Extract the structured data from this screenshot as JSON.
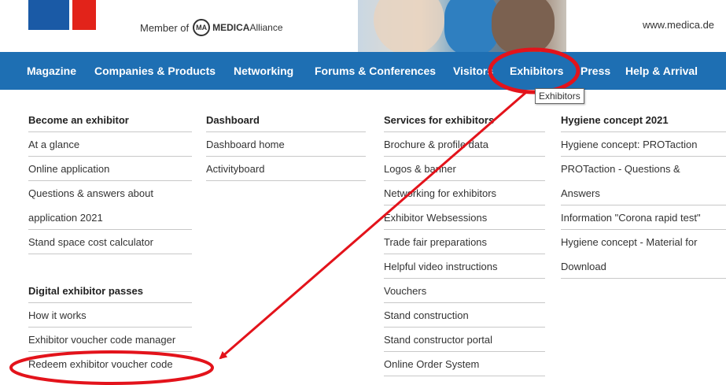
{
  "header": {
    "member_prefix": "Member of",
    "alliance_mark": "MA",
    "alliance_brand_bold": "MEDICA",
    "alliance_brand_rest": "Alliance",
    "site_url": "www.medica.de"
  },
  "nav": {
    "items": [
      {
        "label": "Magazine"
      },
      {
        "label": "Companies & Products"
      },
      {
        "label": "Networking"
      },
      {
        "label": "Forums & Conferences"
      },
      {
        "label": "Visitors"
      },
      {
        "label": "Exhibitors"
      },
      {
        "label": "Press"
      },
      {
        "label": "Help & Arrival"
      }
    ],
    "active": "Exhibitors",
    "tooltip": "Exhibitors"
  },
  "menu": {
    "col1": {
      "items": [
        "Become an exhibitor",
        "At a glance",
        "Online application",
        "Questions & answers about",
        "application 2021",
        "Stand space cost calculator"
      ],
      "section2": [
        "Digital exhibitor passes",
        "How it works",
        "Exhibitor voucher code manager",
        "Redeem exhibitor voucher code"
      ]
    },
    "col2": {
      "items": [
        "Dashboard",
        "Dashboard home",
        "Activityboard"
      ]
    },
    "col3": {
      "items": [
        "Services for exhibitors",
        "Brochure & profile data",
        "Logos & banner",
        "Networking for exhibitors",
        "Exhibitor Websessions",
        "Trade fair preparations",
        "Helpful video instructions",
        "Vouchers",
        "Stand construction",
        "Stand constructor portal",
        "Online Order System"
      ]
    },
    "col4": {
      "items": [
        "Hygiene concept 2021",
        "Hygiene concept: PROTaction",
        "PROTaction - Questions &",
        "Answers",
        "Information \"Corona rapid test\"",
        "Hygiene concept - Material for",
        "Download"
      ]
    }
  },
  "colors": {
    "nav_bg": "#1e6fb3",
    "annotation": "#e3131b",
    "logo_blue": "#1a5aa6",
    "logo_red": "#e2231a"
  }
}
